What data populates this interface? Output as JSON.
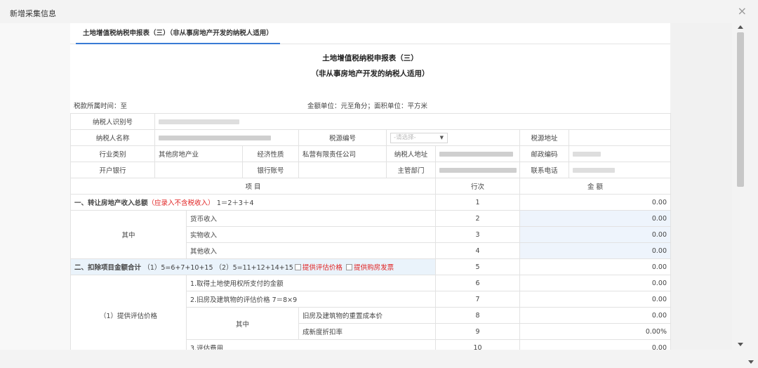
{
  "dialog": {
    "title": "新增采集信息",
    "close": "×"
  },
  "tab": {
    "label": "土地增值税纳税申报表（三）（非从事房地产开发的纳税人适用）"
  },
  "form": {
    "title_line1": "土地增值税纳税申报表（三）",
    "title_line2": "（非从事房地产开发的纳税人适用）",
    "period_label": "税款所属时间：至",
    "unit_label": "金额单位：元至角分；面积单位：平方米"
  },
  "info": {
    "taxpayer_id_label": "纳税人识别号",
    "taxpayer_name_label": "纳税人名称",
    "tax_source_no_label": "税源编号",
    "tax_source_no_placeholder": "-请选择-",
    "tax_source_addr_label": "税源地址",
    "industry_label": "行业类别",
    "industry_value": "其他房地产业",
    "econ_nature_label": "经济性质",
    "econ_nature_value": "私营有限责任公司",
    "taxpayer_addr_label": "纳税人地址",
    "postal_code_label": "邮政编码",
    "bank_label": "开户银行",
    "account_label": "银行账号",
    "authority_label": "主管部门",
    "phone_label": "联系电话"
  },
  "headers": {
    "item": "项 目",
    "line": "行次",
    "amount": "金 额"
  },
  "sec1": {
    "label": "一、转让房地产收入总额",
    "note": "（应录入不含税收入）",
    "formula": "1＝2＋3＋4",
    "line": "1",
    "amount": "0.00"
  },
  "sec1_of_which": "其中",
  "sec1_rows": [
    {
      "label": "货币收入",
      "line": "2",
      "amount": "0.00"
    },
    {
      "label": "实物收入",
      "line": "3",
      "amount": "0.00"
    },
    {
      "label": "其他收入",
      "line": "4",
      "amount": "0.00"
    }
  ],
  "sec2": {
    "label": "二、扣除项目金额合计",
    "formula": "（1）5=6+7+10+15 （2）5=11+12+14+15",
    "opt1": "提供评估价格",
    "opt2": "提供购房发票",
    "line": "5",
    "amount": "0.00"
  },
  "sub1": {
    "label": "（1）提供评估价格"
  },
  "sub1_rows": {
    "r6": {
      "label": "1.取得土地使用权所支付的金额",
      "line": "6",
      "amount": "0.00"
    },
    "r7": {
      "label": "2.旧房及建筑物的评估价格 7＝8×9",
      "line": "7",
      "amount": "0.00"
    },
    "of_which": "其中",
    "r8": {
      "label": "旧房及建筑物的重置成本价",
      "line": "8",
      "amount": "0.00"
    },
    "r9": {
      "label": "成新度折扣率",
      "line": "9",
      "amount": "0.00%"
    },
    "r10": {
      "label": "3.评估费用",
      "line": "10",
      "amount": "0.00"
    }
  }
}
